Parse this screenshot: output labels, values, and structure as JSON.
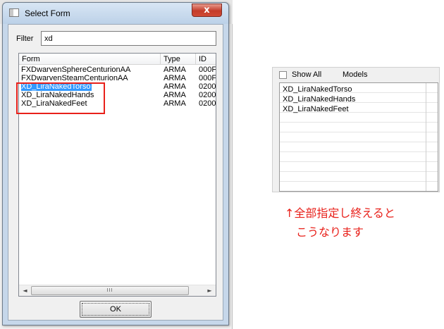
{
  "dialog": {
    "title": "Select Form",
    "close_glyph": "x",
    "filter_label": "Filter",
    "filter_value": "xd",
    "columns": {
      "form": "Form",
      "type": "Type",
      "id": "ID"
    },
    "rows": [
      {
        "form": "FXDwarvenSphereCenturionAA",
        "type": "ARMA",
        "id": "000F"
      },
      {
        "form": "FXDwarvenSteamCenturionAA",
        "type": "ARMA",
        "id": "000F"
      },
      {
        "form": "XD_LiraNakedTorso",
        "type": "ARMA",
        "id": "0200"
      },
      {
        "form": "XD_LiraNakedHands",
        "type": "ARMA",
        "id": "0200"
      },
      {
        "form": "XD_LiraNakedFeet",
        "type": "ARMA",
        "id": "0200"
      }
    ],
    "selected_row": 2,
    "scroll_left": "◄",
    "scroll_right": "►",
    "scroll_thumb": "III",
    "ok_label": "OK",
    "highlight_color": "#e8201a",
    "selection_color": "#3399ff"
  },
  "models_panel": {
    "show_all_label": "Show All",
    "show_all_checked": false,
    "models_label": "Models",
    "items": [
      "XD_LiraNakedTorso",
      "XD_LiraNakedHands",
      "XD_LiraNakedFeet"
    ]
  },
  "annotation": {
    "line1": "↑全部指定し終えると",
    "line2": "こうなります",
    "color": "#e8201a"
  }
}
